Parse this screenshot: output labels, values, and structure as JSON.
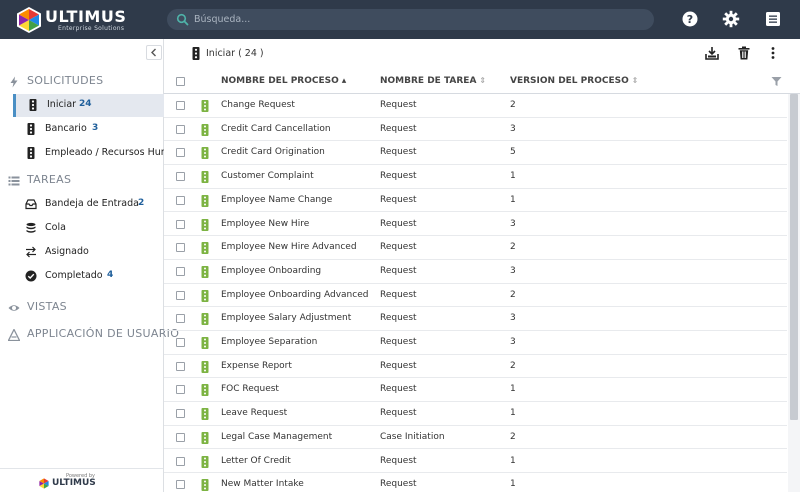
{
  "header": {
    "brand": "ULTIMUS",
    "tagline": "Enterprise Solutions",
    "search_placeholder": "Búsqueda..."
  },
  "sidebar": {
    "sections": {
      "solicitudes": "SOLICITUDES",
      "tareas": "TAREAS",
      "vistas": "VISTAS",
      "aplicacion": "APPLICACIÓN DE USUARIO"
    },
    "solicitudes_items": [
      {
        "label": "Iniciar",
        "count": "24"
      },
      {
        "label": "Bancario",
        "count": "3"
      },
      {
        "label": "Empleado / Recursos Humanos",
        "count": ""
      }
    ],
    "tareas_items": [
      {
        "label": "Bandeja de Entrada",
        "count": "2"
      },
      {
        "label": "Cola",
        "count": ""
      },
      {
        "label": "Asignado",
        "count": ""
      },
      {
        "label": "Completado",
        "count": "4"
      }
    ],
    "powered_by": "Powered by",
    "powered_brand": "ULTIMUS"
  },
  "main": {
    "breadcrumb": "Iniciar ( 24 )",
    "columns": {
      "process": "NOMBRE DEL PROCESO",
      "task": "NOMBRE DE TAREA",
      "version": "VERSION DEL PROCESO"
    },
    "rows": [
      {
        "process": "Change Request",
        "task": "Request",
        "version": "2"
      },
      {
        "process": "Credit Card Cancellation",
        "task": "Request",
        "version": "3"
      },
      {
        "process": "Credit Card Origination",
        "task": "Request",
        "version": "5"
      },
      {
        "process": "Customer Complaint",
        "task": "Request",
        "version": "1"
      },
      {
        "process": "Employee Name Change",
        "task": "Request",
        "version": "1"
      },
      {
        "process": "Employee New Hire",
        "task": "Request",
        "version": "3"
      },
      {
        "process": "Employee New Hire Advanced",
        "task": "Request",
        "version": "2"
      },
      {
        "process": "Employee Onboarding",
        "task": "Request",
        "version": "3"
      },
      {
        "process": "Employee Onboarding Advanced",
        "task": "Request",
        "version": "2"
      },
      {
        "process": "Employee Salary Adjustment",
        "task": "Request",
        "version": "3"
      },
      {
        "process": "Employee Separation",
        "task": "Request",
        "version": "3"
      },
      {
        "process": "Expense Report",
        "task": "Request",
        "version": "2"
      },
      {
        "process": "FOC Request",
        "task": "Request",
        "version": "1"
      },
      {
        "process": "Leave Request",
        "task": "Request",
        "version": "1"
      },
      {
        "process": "Legal Case Management",
        "task": "Case Initiation",
        "version": "2"
      },
      {
        "process": "Letter Of Credit",
        "task": "Request",
        "version": "1"
      },
      {
        "process": "New Matter Intake",
        "task": "Request",
        "version": "1"
      }
    ]
  },
  "colors": {
    "topbar": "#2f3a4a",
    "accent": "#4a8fc4",
    "count": "#1f5f9b",
    "row_icon": "#7cb342"
  }
}
